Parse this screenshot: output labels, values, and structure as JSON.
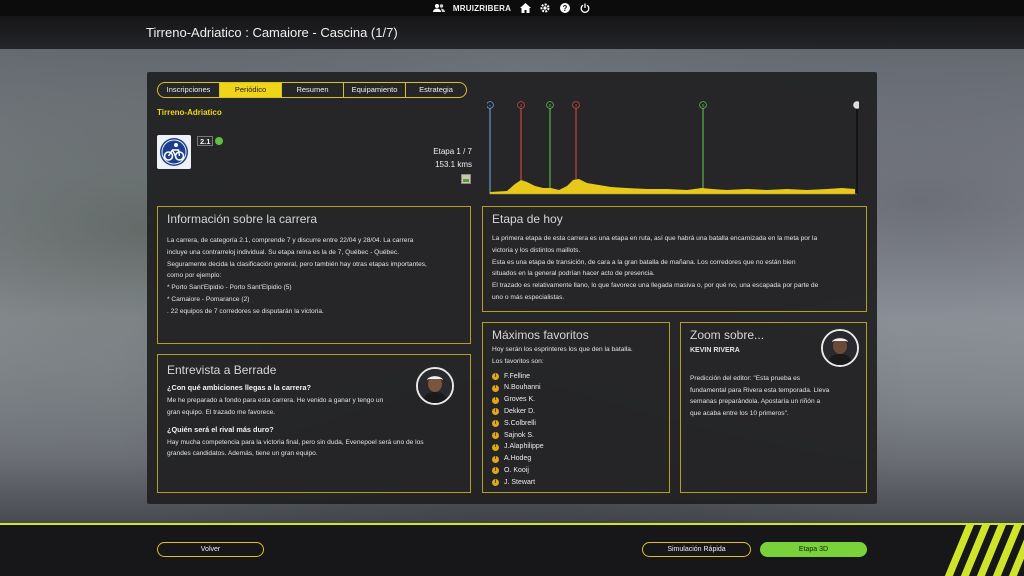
{
  "topbar": {
    "username": "MRUIZRIBERA"
  },
  "header": {
    "title": "Tirreno-Adriatico : Camaiore - Cascina (1/7)"
  },
  "tabs": [
    {
      "label": "Inscripciones",
      "active": false
    },
    {
      "label": "Periódico",
      "active": true
    },
    {
      "label": "Resumen",
      "active": false
    },
    {
      "label": "Equipamiento",
      "active": false
    },
    {
      "label": "Estrategia",
      "active": false
    }
  ],
  "race": {
    "name": "Tirreno-Adriatico",
    "category": "2.1",
    "stage": "Etapa 1 / 7",
    "distance": "153.1 kms"
  },
  "profile_markers": [
    {
      "type": "start",
      "color": "#6fa0d8",
      "symbol": "»"
    },
    {
      "type": "climb",
      "color": "#d24848",
      "symbol": "3"
    },
    {
      "type": "sprint",
      "color": "#5fbf48",
      "symbol": "S"
    },
    {
      "type": "climb",
      "color": "#d24848",
      "symbol": "3"
    },
    {
      "type": "sprint",
      "color": "#5fbf48",
      "symbol": "S"
    },
    {
      "type": "finish",
      "color": "#e0e0e0",
      "symbol": ""
    }
  ],
  "info": {
    "title": "Información sobre la carrera",
    "lines": [
      "La carrera, de categoría 2.1, comprende 7 y discurre entre 22/04 y 28/04. La carrera",
      "incluye una contrarreloj individual. Su etapa reina es la de 7, Québec - Québec.",
      "Seguramente decida la clasificación general, pero también hay otras etapas importantes,",
      "como por ejemplo:",
      " * Porto Sant'Elpidio - Porto Sant'Elpidio (5)",
      " * Camaiore - Pomarance (2)",
      ". 22 equipos de 7 corredores se disputarán la victoria."
    ]
  },
  "today": {
    "title": "Etapa de hoy",
    "lines": [
      "La primera etapa de esta carrera es una etapa en ruta, así que habrá una batalla encarnizada en la meta por la",
      "victoria y los distintos maillots.",
      "Esta es una etapa de transición, de cara a la gran batalla de mañana. Los corredores que no están bien",
      "situados en la general podrían hacer acto de presencia.",
      "El trazado es relativamente llano, lo que favorece una llegada masiva o, por qué no, una escapada por parte de",
      "uno o más especialistas."
    ]
  },
  "interview": {
    "title": "Entrevista a Berrade",
    "q1": "¿Con qué ambiciones llegas a la carrera?",
    "a1": [
      "Me he preparado a fondo para esta carrera. He venido a ganar y tengo un",
      "gran equipo. El trazado me favorece."
    ],
    "q2": "¿Quién será el rival más duro?",
    "a2": [
      "Hay mucha competencia para la victoria final, pero sin duda, Evenepoel será uno de los",
      "grandes candidatos. Además, tiene un gran equipo."
    ]
  },
  "favorites": {
    "title": "Máximos favoritos",
    "intro": [
      "Hoy serán los esprinteres los que den la batalla.",
      "Los favoritos son:"
    ],
    "riders": [
      "F.Felline",
      "N.Bouhanni",
      "Groves K.",
      "Dekker D.",
      "S.Colbrelli",
      "Sajnok S.",
      "J.Alaphilippe",
      "A.Hodeg",
      "O. Kooij",
      "J. Stewart"
    ]
  },
  "zoom": {
    "title": "Zoom sobre...",
    "rider": "KEVIN RIVERA",
    "lines": [
      "Predicción del editor:  \"Esta prueba es",
      "fundamental para Rivera esta temporada. Lleva",
      "semanas preparándola. Apostaría un riñón a",
      "que acaba entre los 10 primeros\"."
    ]
  },
  "footer": {
    "back": "Volver",
    "quick_sim": "Simulación Rápida",
    "stage3d": "Etapa 3D"
  },
  "colors": {
    "accent": "#efd51a",
    "border": "#b69f1e",
    "green": "#7ad23a"
  }
}
